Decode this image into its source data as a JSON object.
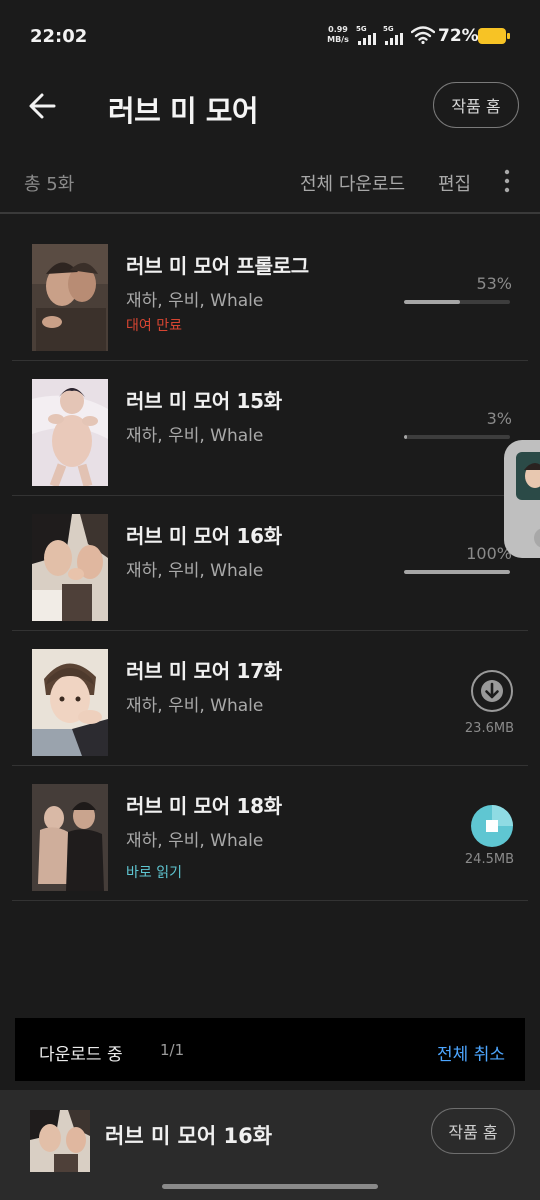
{
  "status_bar": {
    "time": "22:02",
    "net_speed_value": "0.99",
    "net_speed_unit": "MB/s",
    "sim1": "5G",
    "sim2": "5G",
    "battery": "72%",
    "battery_color": "#f7c325"
  },
  "header": {
    "back_icon": "arrow-left-icon",
    "title": "러브 미 모어",
    "home_button": "작품 홈"
  },
  "toolbar": {
    "total_count": "총 5화",
    "download_all": "전체 다운로드",
    "edit": "편집",
    "more_icon": "more-vertical-icon"
  },
  "episodes": [
    {
      "title": "러브 미 모어 프롤로그",
      "authors": "재하, 우비, Whale",
      "status_label": "대여 만료",
      "status_color": "#d64532",
      "progress_text": "53%",
      "progress": 0.53
    },
    {
      "title": "러브 미 모어 15화",
      "authors": "재하, 우비, Whale",
      "progress_text": "3%",
      "progress": 0.03
    },
    {
      "title": "러브 미 모어 16화",
      "authors": "재하, 우비, Whale",
      "progress_text": "100%",
      "progress": 1.0
    },
    {
      "title": "러브 미 모어 17화",
      "authors": "재하, 우비, Whale",
      "action_icon": "download-icon",
      "size": "23.6MB"
    },
    {
      "title": "러브 미 모어 18화",
      "authors": "재하, 우비, Whale",
      "status_label": "바로 읽기",
      "status_color": "#5fc6d2",
      "action_icon": "stop-download-icon",
      "size": "24.5MB"
    }
  ],
  "download_banner": {
    "label": "다운로드 중",
    "count": "1/1",
    "cancel_all": "전체 취소",
    "cancel_color": "#4da6ff"
  },
  "now_reading": {
    "title": "러브 미 모어 16화",
    "home_button": "작품 홈"
  },
  "colors": {
    "background": "#1b1b1b",
    "accent_teal": "#5fc6d2"
  }
}
